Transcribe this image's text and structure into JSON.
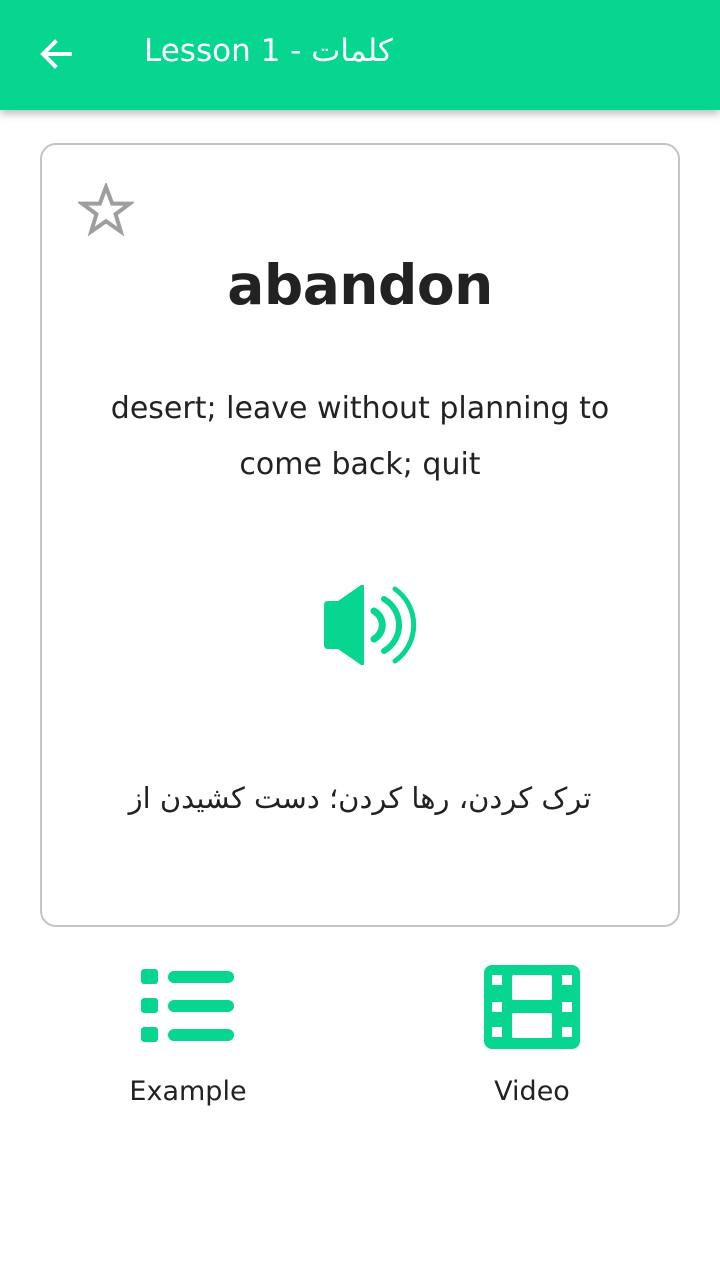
{
  "colors": {
    "accent": "#06d68f",
    "text": "#222222",
    "card_border": "#c4c4c4",
    "star_outline": "#9e9e9e"
  },
  "appbar": {
    "back_icon": "arrow-left-icon",
    "title": "Lesson 1 - كلمات"
  },
  "card": {
    "favorite_icon": "star-outline-icon",
    "word": "abandon",
    "definition": "desert; leave without planning to come back; quit",
    "pronounce_icon": "speaker-volume-icon",
    "translation": "ترک کردن، رها کردن؛ دست کشیدن از"
  },
  "actions": {
    "example": {
      "label": "Example",
      "icon": "list-icon"
    },
    "video": {
      "label": "Video",
      "icon": "film-icon"
    }
  }
}
